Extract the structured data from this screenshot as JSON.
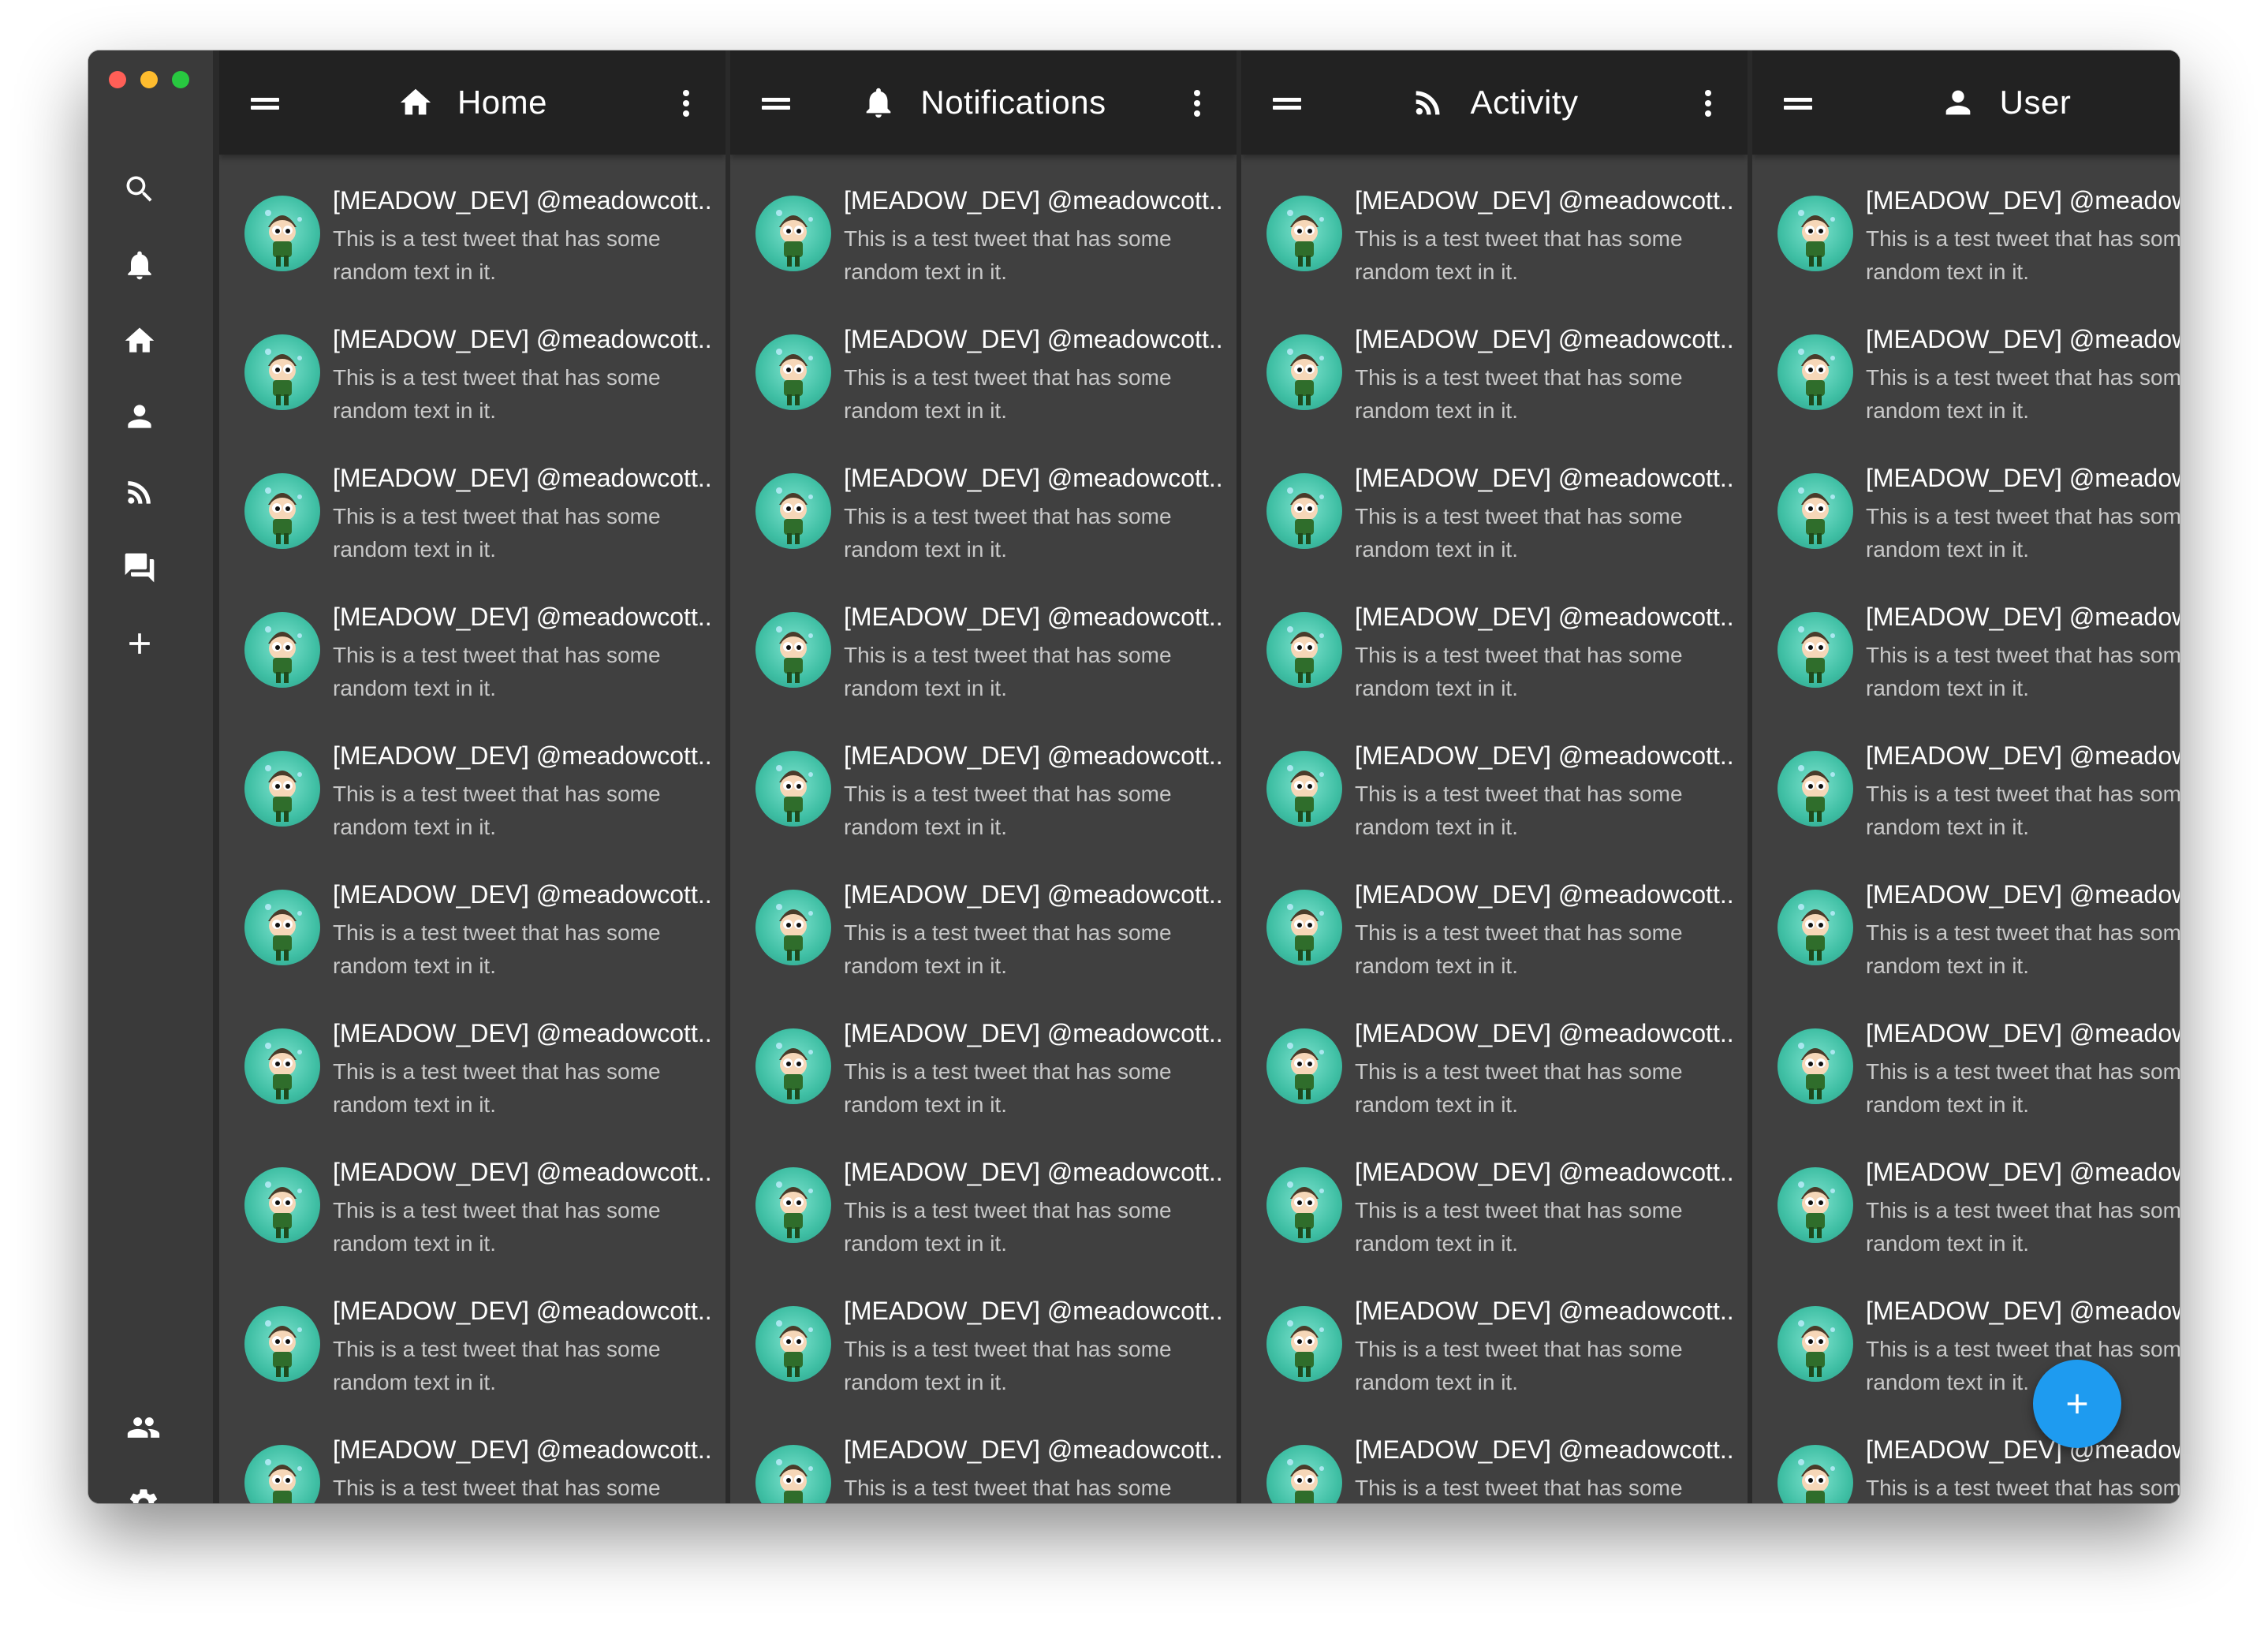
{
  "sidebar": {
    "icons": [
      "search-icon",
      "bell-icon",
      "home-icon",
      "person-icon",
      "rss-icon",
      "chat-icon",
      "plus-icon",
      "people-icon",
      "gear-icon"
    ]
  },
  "columns": [
    {
      "title": "Home",
      "icon": "home-icon"
    },
    {
      "title": "Notifications",
      "icon": "bell-icon"
    },
    {
      "title": "Activity",
      "icon": "rss-icon"
    },
    {
      "title": "User",
      "icon": "person-icon"
    }
  ],
  "tweets": [
    {
      "author": "[MEADOW_DEV] @meadowcott..",
      "text": "This is a test tweet that has some random text in it."
    },
    {
      "author": "[MEADOW_DEV] @meadowcott..",
      "text": "This is a test tweet that has some random text in it."
    },
    {
      "author": "[MEADOW_DEV] @meadowcott..",
      "text": "This is a test tweet that has some random text in it."
    },
    {
      "author": "[MEADOW_DEV] @meadowcott..",
      "text": "This is a test tweet that has some random text in it."
    },
    {
      "author": "[MEADOW_DEV] @meadowcott..",
      "text": "This is a test tweet that has some random text in it."
    },
    {
      "author": "[MEADOW_DEV] @meadowcott..",
      "text": "This is a test tweet that has some random text in it."
    },
    {
      "author": "[MEADOW_DEV] @meadowcott..",
      "text": "This is a test tweet that has some random text in it."
    },
    {
      "author": "[MEADOW_DEV] @meadowcott..",
      "text": "This is a test tweet that has some random text in it."
    },
    {
      "author": "[MEADOW_DEV] @meadowcott..",
      "text": "This is a test tweet that has some random text in it."
    },
    {
      "author": "[MEADOW_DEV] @meadowcott..",
      "text": "This is a test tweet that has some random text in it."
    }
  ],
  "fab": {
    "icon": "plus-icon"
  },
  "colors": {
    "header": "#222222",
    "column": "#404040",
    "sidebar": "#3a3a3a",
    "fab": "#1e9bf0"
  }
}
